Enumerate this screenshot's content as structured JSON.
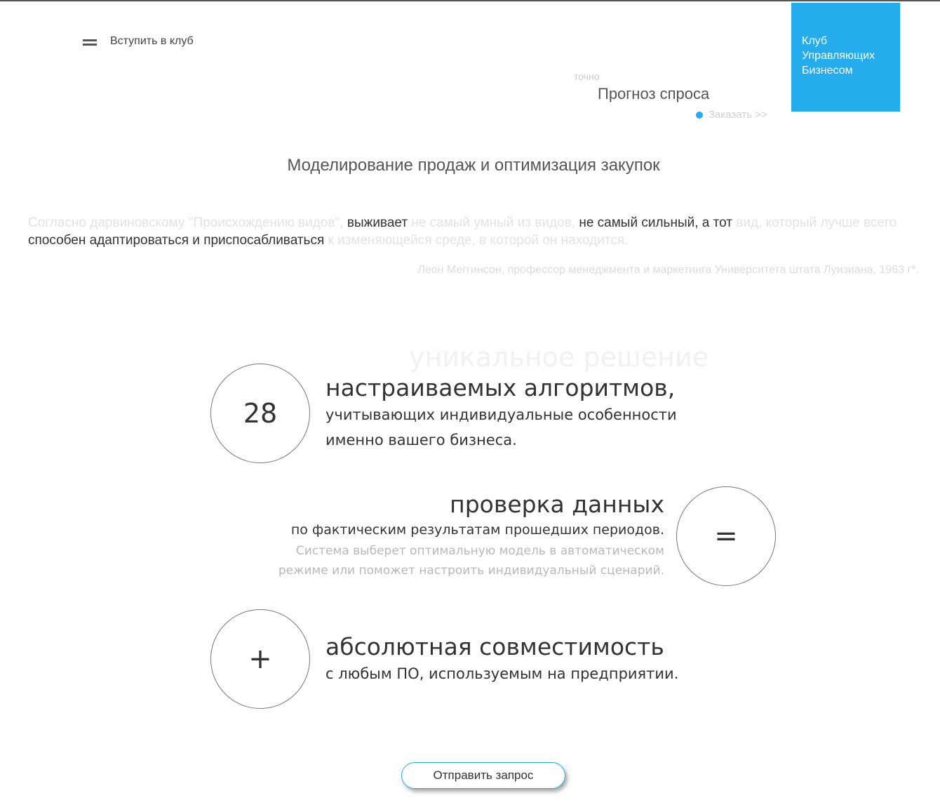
{
  "nav": {
    "menu_label": "Вступить в клуб",
    "menu_icon": "hamburger-icon"
  },
  "logo": {
    "line1": "Клуб",
    "line2": "Управляющих",
    "line3": "Бизнесом",
    "color": "#25acec"
  },
  "service": {
    "tag": "точно",
    "title": "Прогноз спроса",
    "order_label": "Заказать >>",
    "order_icon": "dot-icon"
  },
  "heading": "Моделирование продаж и оптимизация закупок",
  "quote": {
    "part1": "Согласно дарвиновскому \"Происхождению видов\", ",
    "part2": "выживает",
    "part3": " не самый умный из видов, ",
    "part4": "не самый сильный, а тот",
    "part5": " вид, который лучше всего ",
    "part6": "способен адаптироваться и приспосабливаться",
    "part7": " к изменяющейся среде, в которой он находится.",
    "author": "Леон Меггинсон, профессор менеджмента и маркетинга Университета штата Луизиана, 1963 г*."
  },
  "tagline": "уникальное решение",
  "features": [
    {
      "symbol": "28",
      "head": "настраиваемых алгоритмов,",
      "line1": "учитывающих индивидуальные особенности",
      "line2": "именно вашего бизнеса."
    },
    {
      "symbol": "=",
      "head": "проверка данных",
      "line1": "по фактическим результатам прошедших периодов.",
      "muted1": "Система выберет оптимальную модель в автоматическом",
      "muted2": "режиме или поможет настроить индивидуальный сценарий."
    },
    {
      "symbol": "+",
      "head": "абсолютная совместимость",
      "line1": "с любым ПО, используемым на предприятии."
    }
  ],
  "cta": {
    "label": "Отправить запрос"
  }
}
